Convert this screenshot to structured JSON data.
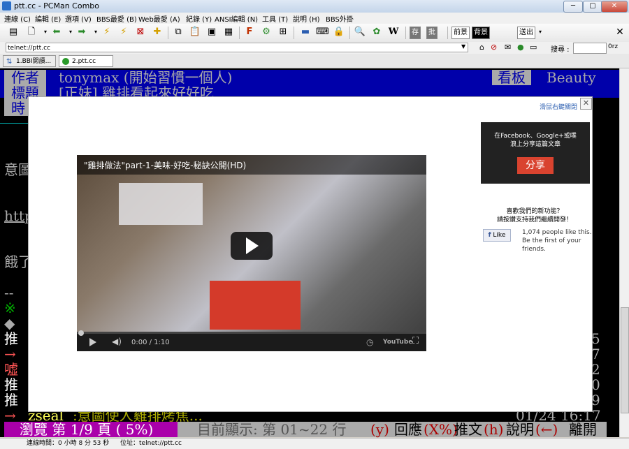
{
  "window": {
    "title": "ptt.cc - PCMan Combo"
  },
  "menu": [
    "連線 (C)",
    "編輯 (E)",
    "選項 (V)",
    "BBS最愛 (B)",
    "Web最愛 (A)",
    "紀錄 (Y)",
    "ANSI編輯 (N)",
    "工具 (T)",
    "說明 (H)",
    "BBS外掛"
  ],
  "toolbar": {
    "text_btns": [
      "存",
      "批"
    ],
    "front": "前景",
    "back": "背景",
    "blink": "閃爍",
    "send": "送出"
  },
  "address": {
    "value": "telnet://ptt.cc",
    "search_label": "搜尋 :",
    "search_value": "0rz"
  },
  "tabs": [
    {
      "label": "1.BBI閱讀..."
    },
    {
      "label": "2.ptt.cc"
    }
  ],
  "terminal": {
    "header": {
      "author_label": "作者",
      "author": "tonymax (開始習慣一個人)",
      "board_label": "看板",
      "board": "Beauty",
      "title_label": "標題",
      "title": "[正妹] 雞排看起來好好吃",
      "time_label": "時"
    },
    "partial_lines": [
      "意圖",
      "http",
      "餓了",
      "--",
      "※",
      "◆"
    ],
    "push_tags": [
      "推",
      "→",
      "噓",
      "推",
      "推",
      "→"
    ],
    "right_digits": [
      "5",
      "7",
      "2",
      "0",
      "9"
    ],
    "last_push": {
      "user": "zseal",
      "text": ":意圖使人雞排烤焦...",
      "time": "01/24 16:17"
    },
    "footer": {
      "browse": "瀏覽 第 1/9 頁 ( 5%)",
      "showing": "目前顯示: 第 01~22 行",
      "y": "(y)",
      "reply": "回應",
      "x": "(X%)",
      "push": "推文",
      "h": "(h)",
      "help": "說明",
      "left": "(←)",
      "leave": "離開"
    }
  },
  "overlay": {
    "hint": "滑鼠右鍵關閉",
    "video": {
      "title": "\"雞排做法\"part-1-美味-好吃-秘訣公開(HD)",
      "time": "0:00 / 1:10",
      "brand": "YouTube"
    },
    "share": {
      "text1": "在Facebook、Google+或噗",
      "text2": "浪上分享這篇文章",
      "button": "分享"
    },
    "promo": {
      "line1": "喜歡我們的新功能？",
      "line2": "請按讚支持我們繼續開發！"
    },
    "like": {
      "button": "Like",
      "text1": "1,074 people like this.",
      "text2": "Be the first of your",
      "text3": "friends."
    }
  },
  "status": {
    "conn_time": "連線時間：0 小時 8 分 53 秒",
    "location": "位址：telnet://ptt.cc"
  }
}
